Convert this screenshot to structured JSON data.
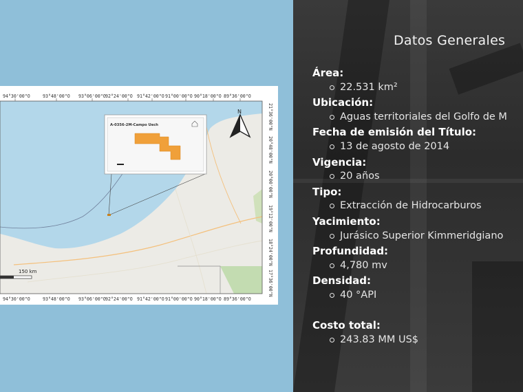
{
  "panel": {
    "title": "Datos Generales",
    "fields": [
      {
        "label": "Área:",
        "value": "22.531 km²"
      },
      {
        "label": "Ubicación:",
        "value": "Aguas territoriales del Golfo de M"
      },
      {
        "label": "Fecha de emisión del Título:",
        "value": "13 de agosto de 2014"
      },
      {
        "label": "Vigencia:",
        "value": "20 años"
      },
      {
        "label": "Tipo:",
        "value": "Extracción de Hidrocarburos"
      },
      {
        "label": "Yacimiento:",
        "value": "Jurásico Superior Kimmeridgiano"
      },
      {
        "label": "Profundidad:",
        "value": "4,780 mv"
      },
      {
        "label": "Densidad:",
        "value": "40 °API"
      }
    ],
    "cost": {
      "label": "Costo total:",
      "value": "243.83 MM US$"
    }
  },
  "map": {
    "lon_ticks_top": [
      "94°30'00\"O",
      "93°48'00\"O",
      "93°06'00\"O",
      "92°24'00\"O",
      "91°42'00\"O",
      "91°00'00\"O",
      "90°18'00\"O",
      "89°36'00\"O"
    ],
    "lon_ticks_bottom": [
      "94°30'00\"O",
      "93°48'00\"O",
      "93°06'00\"O",
      "92°24'00\"O",
      "91°42'00\"O",
      "91°00'00\"O",
      "90°18'00\"O",
      "89°36'00\"O"
    ],
    "lat_ticks": [
      "21°36'00\"N",
      "20°48'00\"N",
      "20°00'00\"N",
      "19°12'00\"N",
      "18°24'00\"N",
      "17°36'00\"N"
    ],
    "scale_label": "150 km",
    "north_label": "N",
    "inset_title": "A-0356-2M-Campo Uech",
    "colors": {
      "sea": "#b3d7ea",
      "land": "#ecebe6",
      "block": "#f0a03a",
      "background": "#8fbfd9"
    }
  }
}
